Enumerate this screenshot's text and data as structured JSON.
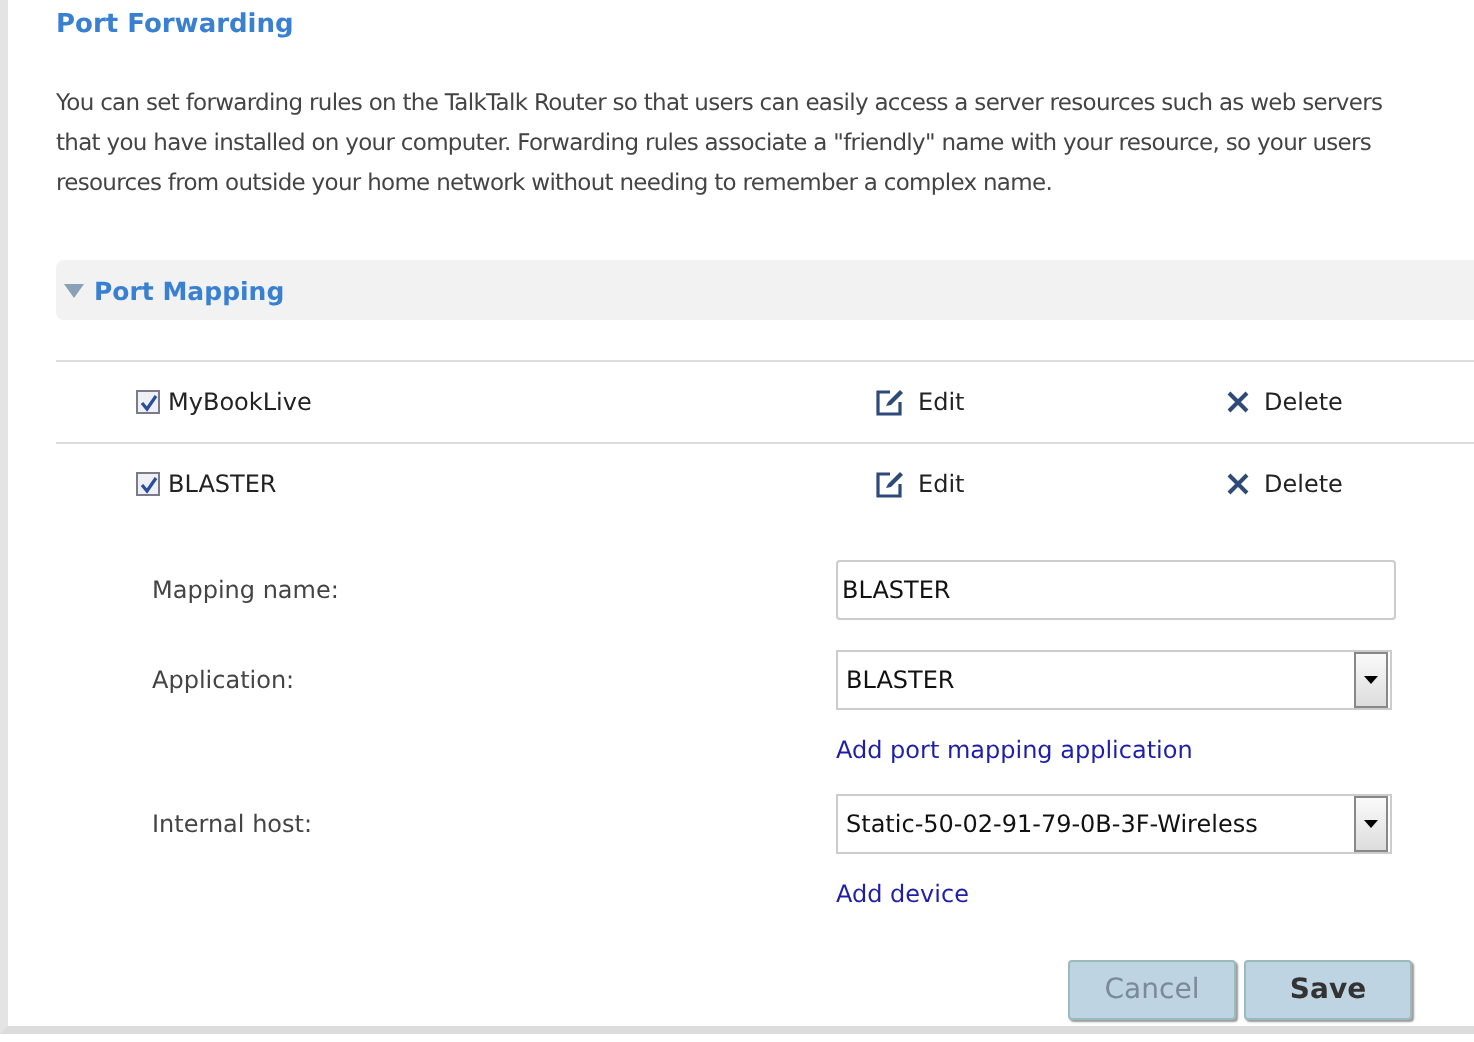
{
  "title": "Port Forwarding",
  "description": [
    "You can set forwarding rules on the TalkTalk Router so that users can easily access a server resources such as web servers",
    "that you have installed on your computer. Forwarding rules associate a \"friendly\" name with your resource, so your users",
    "resources from outside your home network without needing to remember a complex name."
  ],
  "section": {
    "label": "Port Mapping",
    "expanded": true
  },
  "mappings": [
    {
      "name": "MyBookLive",
      "checked": true,
      "edit": "Edit",
      "delete": "Delete"
    },
    {
      "name": "BLASTER",
      "checked": true,
      "edit": "Edit",
      "delete": "Delete"
    }
  ],
  "form": {
    "fields": [
      {
        "kind": "text",
        "label": "Mapping name:",
        "value": "BLASTER"
      },
      {
        "kind": "select",
        "label": "Application:",
        "value": "BLASTER",
        "link": "Add port mapping application"
      },
      {
        "kind": "select",
        "label": "Internal host:",
        "value": "Static-50-02-91-79-0B-3F-Wireless",
        "link": "Add device"
      }
    ]
  },
  "buttons": [
    {
      "label": "Cancel",
      "disabled": true
    },
    {
      "label": "Save",
      "disabled": false
    }
  ]
}
